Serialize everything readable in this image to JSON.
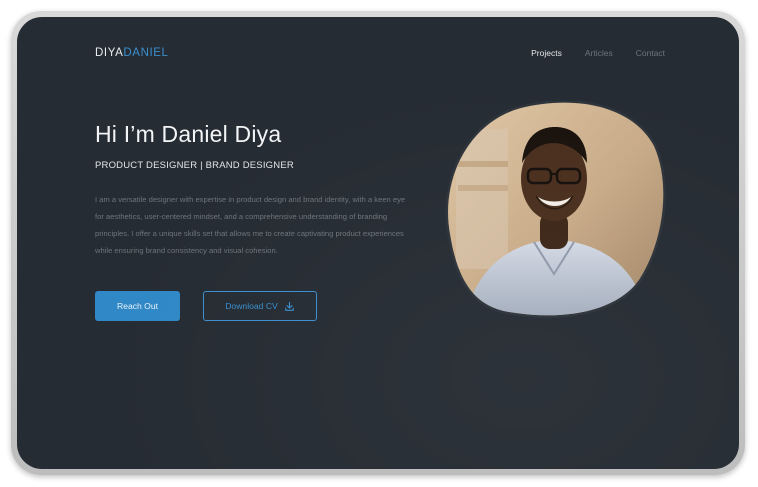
{
  "logo": {
    "part1": "DIYA",
    "part2": "DANIEL"
  },
  "nav": {
    "projects": "Projects",
    "articles": "Articles",
    "contact": "Contact"
  },
  "hero": {
    "title": "Hi I’m Daniel Diya",
    "subtitle": "PRODUCT DESIGNER | BRAND DESIGNER",
    "bio": "I am a versatile designer with expertise in product design and brand identity, with a keen eye for aesthetics, user-centered mindset, and a comprehensive understanding of branding principles. I offer a unique skills set that allows me to create captivating product experiences while ensuring brand consistency and visual cohesion."
  },
  "buttons": {
    "reach_out": "Reach Out",
    "download_cv": "Download CV"
  },
  "colors": {
    "background": "#262c33",
    "accent": "#3088c6",
    "frame": "#c9c9c9"
  },
  "icons": {
    "download": "download-icon"
  }
}
